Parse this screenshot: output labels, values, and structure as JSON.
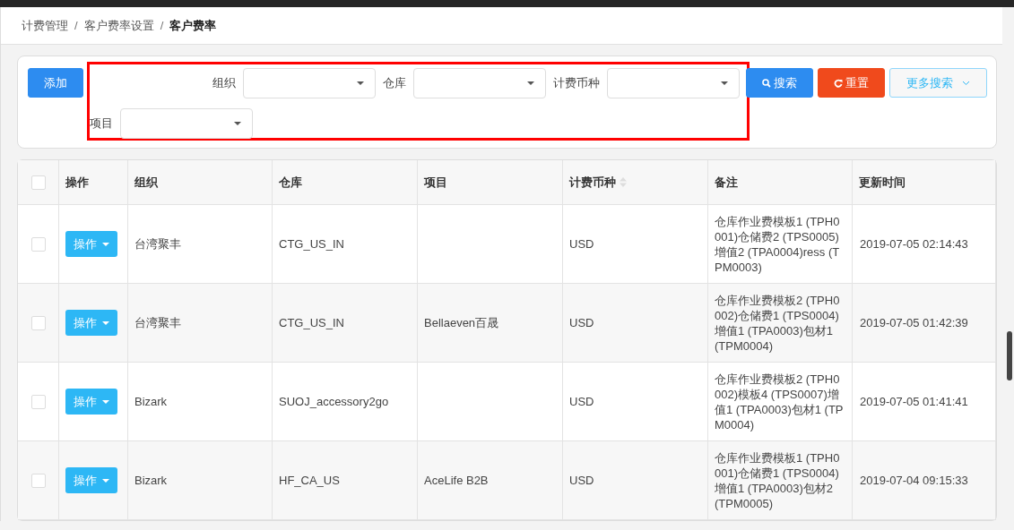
{
  "breadcrumb": [
    {
      "label": "计费管理",
      "current": false
    },
    {
      "label": "客户费率设置",
      "current": false
    },
    {
      "label": "客户费率",
      "current": true
    }
  ],
  "breadcrumb_separator": "/",
  "add_button": "添加",
  "filters": [
    {
      "label": "组织"
    },
    {
      "label": "仓库"
    },
    {
      "label": "计费币种"
    },
    {
      "label": "项目"
    }
  ],
  "search_button": "搜索",
  "reset_button": "重置",
  "more_search_button": "更多搜索",
  "table": {
    "all_checked": false,
    "columns": [
      {
        "label": "操作",
        "sortable": false
      },
      {
        "label": "组织",
        "sortable": false
      },
      {
        "label": "仓库",
        "sortable": false
      },
      {
        "label": "项目",
        "sortable": false
      },
      {
        "label": "计费币种",
        "sortable": true
      },
      {
        "label": "备注",
        "sortable": false
      },
      {
        "label": "更新时间",
        "sortable": false
      }
    ],
    "rows": [
      {
        "checked": false,
        "action": "操作",
        "org": "台湾聚丰",
        "warehouse": "CTG_US_IN",
        "project": "",
        "currency": "USD",
        "note": "仓库作业费模板1 (TPH0001)仓储费2 (TPS0005)增值2 (TPA0004)ress (TPM0003)",
        "updated": "2019-07-05 02:14:43"
      },
      {
        "checked": false,
        "action": "操作",
        "org": "台湾聚丰",
        "warehouse": "CTG_US_IN",
        "project": "Bellaeven百晟",
        "currency": "USD",
        "note": "仓库作业费模板2 (TPH0002)仓储费1 (TPS0004)增值1 (TPA0003)包材1 (TPM0004)",
        "updated": "2019-07-05 01:42:39"
      },
      {
        "checked": false,
        "action": "操作",
        "org": "Bizark",
        "warehouse": "SUOJ_accessory2go",
        "project": "",
        "currency": "USD",
        "note": "仓库作业费模板2 (TPH0002)模板4 (TPS0007)增值1 (TPA0003)包材1 (TPM0004)",
        "updated": "2019-07-05 01:41:41"
      },
      {
        "checked": false,
        "action": "操作",
        "org": "Bizark",
        "warehouse": "HF_CA_US",
        "project": "AceLife B2B",
        "currency": "USD",
        "note": "仓库作业费模板1 (TPH0001)仓储费1 (TPS0004)增值1 (TPA0003)包材2 (TPM0005)",
        "updated": "2019-07-04 09:15:33"
      }
    ]
  }
}
